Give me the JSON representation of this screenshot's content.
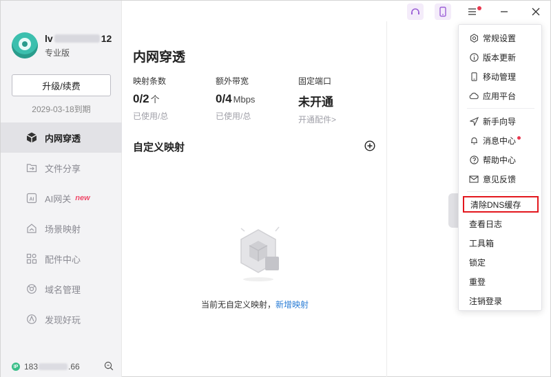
{
  "user": {
    "name_prefix": "lv",
    "name_suffix": "12",
    "plan": "专业版",
    "upgrade_label": "升级/续费",
    "expiry": "2029-03-18到期"
  },
  "nav": {
    "items": [
      {
        "label": "内网穿透",
        "icon": "cube-icon",
        "active": true
      },
      {
        "label": "文件分享",
        "icon": "folder-share-icon"
      },
      {
        "label": "AI网关",
        "icon": "ai-icon",
        "badge": "new"
      },
      {
        "label": "场景映射",
        "icon": "house-icon"
      },
      {
        "label": "配件中心",
        "icon": "grid-icon"
      },
      {
        "label": "域名管理",
        "icon": "globe-icon"
      },
      {
        "label": "发现好玩",
        "icon": "compass-icon"
      }
    ]
  },
  "footer": {
    "ip_badge": "IP",
    "ip_prefix": "183",
    "ip_suffix": ".66"
  },
  "main": {
    "title": "内网穿透",
    "stats": [
      {
        "label": "映射条数",
        "value": "0/2",
        "unit": "个",
        "sub": "已使用/总"
      },
      {
        "label": "额外带宽",
        "value": "0/4",
        "unit": "Mbps",
        "sub": "已使用/总"
      },
      {
        "label": "固定端口",
        "value": "未开通",
        "unit": "",
        "sub": "开通配件>"
      }
    ],
    "section_title": "自定义映射",
    "empty_text": "当前无自定义映射，",
    "empty_link": "新增映射"
  },
  "menu": {
    "group1": [
      "常规设置",
      "版本更新",
      "移动管理",
      "应用平台"
    ],
    "group2": [
      "新手向导",
      "消息中心",
      "帮助中心",
      "意见反馈"
    ],
    "group3": [
      "清除DNS缓存",
      "查看日志",
      "工具箱",
      "锁定",
      "重登",
      "注销登录"
    ]
  },
  "colors": {
    "accent_link": "#2b7ed6",
    "highlight_border": "#e3161d",
    "notify_dot": "#e8384f",
    "avatar": "#3cbfae"
  }
}
